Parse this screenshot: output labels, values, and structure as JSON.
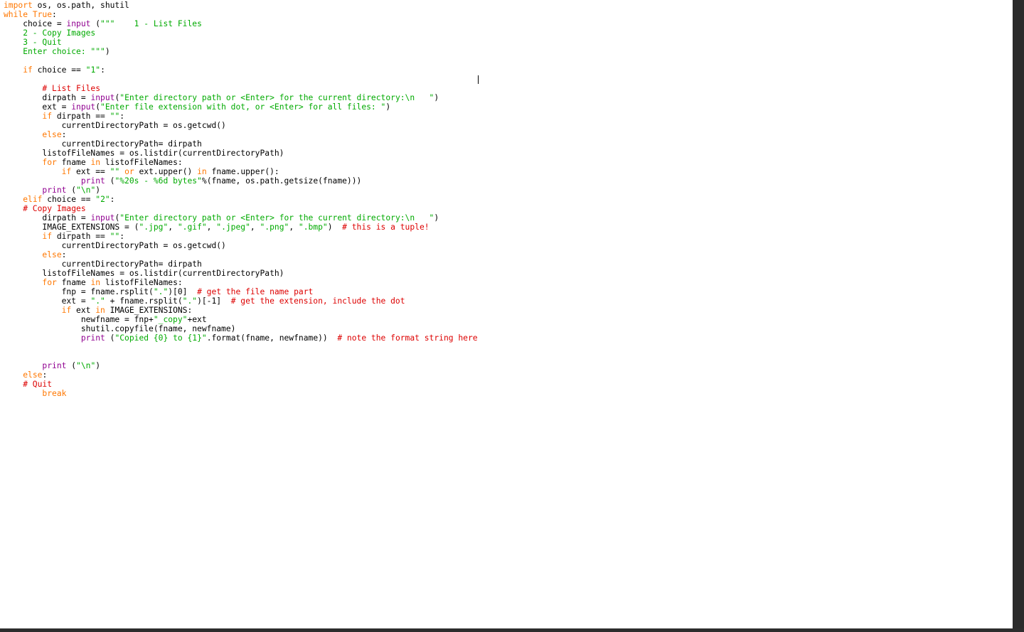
{
  "editor": {
    "colors": {
      "keyword": "#ff7700",
      "builtin": "#900090",
      "string": "#00aa00",
      "comment": "#dd0000",
      "default": "#000000",
      "background": "#ffffff",
      "scrollbar": "#2b2b2b"
    },
    "caret_line": 8,
    "lines": [
      [
        [
          "k",
          "import"
        ],
        [
          "d",
          " os, os.path, shutil"
        ]
      ],
      [
        [
          "k",
          "while"
        ],
        [
          "d",
          " "
        ],
        [
          "k",
          "True"
        ],
        [
          "d",
          ":"
        ]
      ],
      [
        [
          "d",
          "    choice = "
        ],
        [
          "b",
          "input"
        ],
        [
          "d",
          " ("
        ],
        [
          "s",
          "\"\"\"    1 - List Files"
        ]
      ],
      [
        [
          "s",
          "    2 - Copy Images"
        ]
      ],
      [
        [
          "s",
          "    3 - Quit"
        ]
      ],
      [
        [
          "s",
          "    Enter choice: \"\"\""
        ],
        [
          "d",
          ")"
        ]
      ],
      [
        [
          "d",
          ""
        ]
      ],
      [
        [
          "d",
          "    "
        ],
        [
          "k",
          "if"
        ],
        [
          "d",
          " choice == "
        ],
        [
          "s",
          "\"1\""
        ],
        [
          "d",
          ":"
        ]
      ],
      [
        [
          "d",
          "        "
        ]
      ],
      [
        [
          "c",
          "        # List Files"
        ]
      ],
      [
        [
          "d",
          "        dirpath = "
        ],
        [
          "b",
          "input"
        ],
        [
          "d",
          "("
        ],
        [
          "s",
          "\"Enter directory path or <Enter> for the current directory:\\n   \""
        ],
        [
          "d",
          ")"
        ]
      ],
      [
        [
          "d",
          "        ext = "
        ],
        [
          "b",
          "input"
        ],
        [
          "d",
          "("
        ],
        [
          "s",
          "\"Enter file extension with dot, or <Enter> for all files: \""
        ],
        [
          "d",
          ")"
        ]
      ],
      [
        [
          "d",
          "        "
        ],
        [
          "k",
          "if"
        ],
        [
          "d",
          " dirpath == "
        ],
        [
          "s",
          "\"\""
        ],
        [
          "d",
          ":"
        ]
      ],
      [
        [
          "d",
          "            currentDirectoryPath = os.getcwd()"
        ]
      ],
      [
        [
          "d",
          "        "
        ],
        [
          "k",
          "else"
        ],
        [
          "d",
          ":"
        ]
      ],
      [
        [
          "d",
          "            currentDirectoryPath= dirpath"
        ]
      ],
      [
        [
          "d",
          "        listofFileNames = os.listdir(currentDirectoryPath)"
        ]
      ],
      [
        [
          "d",
          "        "
        ],
        [
          "k",
          "for"
        ],
        [
          "d",
          " fname "
        ],
        [
          "k",
          "in"
        ],
        [
          "d",
          " listofFileNames:"
        ]
      ],
      [
        [
          "d",
          "            "
        ],
        [
          "k",
          "if"
        ],
        [
          "d",
          " ext == "
        ],
        [
          "s",
          "\"\""
        ],
        [
          "d",
          " "
        ],
        [
          "k",
          "or"
        ],
        [
          "d",
          " ext.upper() "
        ],
        [
          "k",
          "in"
        ],
        [
          "d",
          " fname.upper():"
        ]
      ],
      [
        [
          "d",
          "                "
        ],
        [
          "b",
          "print"
        ],
        [
          "d",
          " ("
        ],
        [
          "s",
          "\"%20s - %6d bytes\""
        ],
        [
          "d",
          "%(fname, os.path.getsize(fname)))"
        ]
      ],
      [
        [
          "d",
          "        "
        ],
        [
          "b",
          "print"
        ],
        [
          "d",
          " ("
        ],
        [
          "s",
          "\"\\n\""
        ],
        [
          "d",
          ")"
        ]
      ],
      [
        [
          "d",
          "    "
        ],
        [
          "k",
          "elif"
        ],
        [
          "d",
          " choice == "
        ],
        [
          "s",
          "\"2\""
        ],
        [
          "d",
          ":"
        ]
      ],
      [
        [
          "c",
          "    # Copy Images"
        ]
      ],
      [
        [
          "d",
          "        dirpath = "
        ],
        [
          "b",
          "input"
        ],
        [
          "d",
          "("
        ],
        [
          "s",
          "\"Enter directory path or <Enter> for the current directory:\\n   \""
        ],
        [
          "d",
          ")"
        ]
      ],
      [
        [
          "d",
          "        IMAGE_EXTENSIONS = ("
        ],
        [
          "s",
          "\".jpg\""
        ],
        [
          "d",
          ", "
        ],
        [
          "s",
          "\".gif\""
        ],
        [
          "d",
          ", "
        ],
        [
          "s",
          "\".jpeg\""
        ],
        [
          "d",
          ", "
        ],
        [
          "s",
          "\".png\""
        ],
        [
          "d",
          ", "
        ],
        [
          "s",
          "\".bmp\""
        ],
        [
          "d",
          ")  "
        ],
        [
          "c",
          "# this is a tuple!"
        ]
      ],
      [
        [
          "d",
          "        "
        ],
        [
          "k",
          "if"
        ],
        [
          "d",
          " dirpath == "
        ],
        [
          "s",
          "\"\""
        ],
        [
          "d",
          ":"
        ]
      ],
      [
        [
          "d",
          "            currentDirectoryPath = os.getcwd()"
        ]
      ],
      [
        [
          "d",
          "        "
        ],
        [
          "k",
          "else"
        ],
        [
          "d",
          ":"
        ]
      ],
      [
        [
          "d",
          "            currentDirectoryPath= dirpath"
        ]
      ],
      [
        [
          "d",
          "        listofFileNames = os.listdir(currentDirectoryPath)"
        ]
      ],
      [
        [
          "d",
          "        "
        ],
        [
          "k",
          "for"
        ],
        [
          "d",
          " fname "
        ],
        [
          "k",
          "in"
        ],
        [
          "d",
          " listofFileNames:"
        ]
      ],
      [
        [
          "d",
          "            fnp = fname.rsplit("
        ],
        [
          "s",
          "\".\""
        ],
        [
          "d",
          ")[0]  "
        ],
        [
          "c",
          "# get the file name part"
        ]
      ],
      [
        [
          "d",
          "            ext = "
        ],
        [
          "s",
          "\".\""
        ],
        [
          "d",
          " + fname.rsplit("
        ],
        [
          "s",
          "\".\""
        ],
        [
          "d",
          ")[-1]  "
        ],
        [
          "c",
          "# get the extension, include the dot"
        ]
      ],
      [
        [
          "d",
          "            "
        ],
        [
          "k",
          "if"
        ],
        [
          "d",
          " ext "
        ],
        [
          "k",
          "in"
        ],
        [
          "d",
          " IMAGE_EXTENSIONS:"
        ]
      ],
      [
        [
          "d",
          "                newfname = fnp+"
        ],
        [
          "s",
          "\"_copy\""
        ],
        [
          "d",
          "+ext"
        ]
      ],
      [
        [
          "d",
          "                shutil.copyfile(fname, newfname)"
        ]
      ],
      [
        [
          "d",
          "                "
        ],
        [
          "b",
          "print"
        ],
        [
          "d",
          " ("
        ],
        [
          "s",
          "\"Copied {0} to {1}\""
        ],
        [
          "d",
          ".format(fname, newfname))  "
        ],
        [
          "c",
          "# note the format string here"
        ]
      ],
      [
        [
          "d",
          ""
        ]
      ],
      [
        [
          "d",
          ""
        ]
      ],
      [
        [
          "d",
          "        "
        ],
        [
          "b",
          "print"
        ],
        [
          "d",
          " ("
        ],
        [
          "s",
          "\"\\n\""
        ],
        [
          "d",
          ")"
        ]
      ],
      [
        [
          "d",
          "    "
        ],
        [
          "k",
          "else"
        ],
        [
          "d",
          ":"
        ]
      ],
      [
        [
          "c",
          "    # Quit"
        ]
      ],
      [
        [
          "d",
          "        "
        ],
        [
          "k",
          "break"
        ]
      ]
    ]
  }
}
